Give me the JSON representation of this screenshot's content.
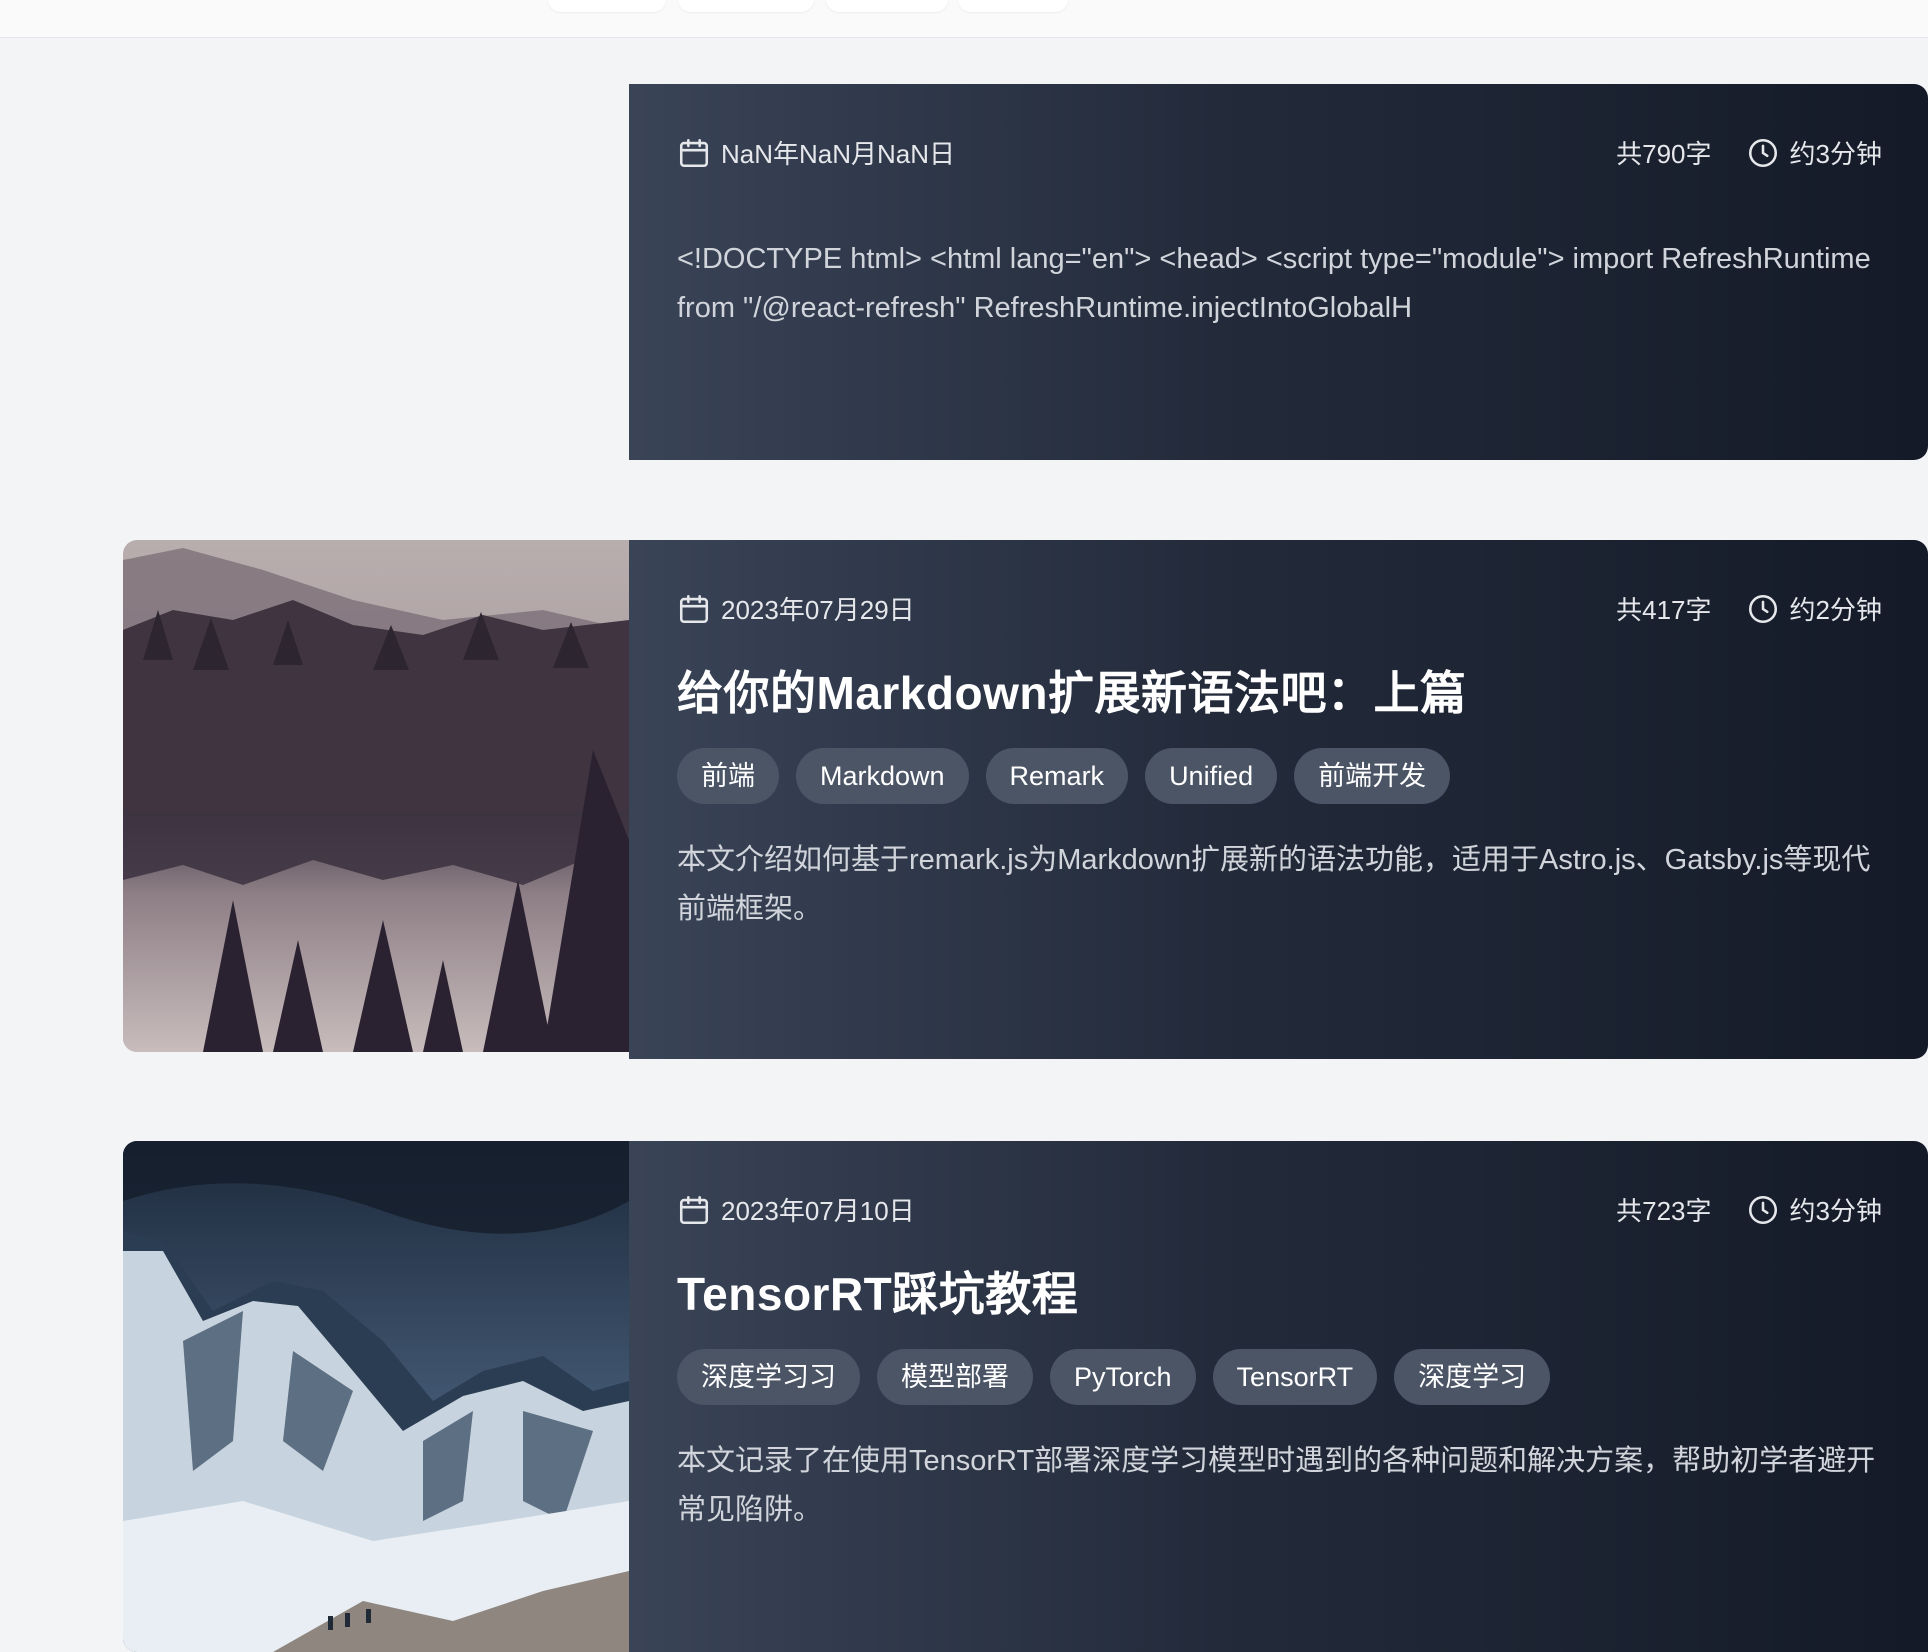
{
  "posts": [
    {
      "date": "NaN年NaN月NaN日",
      "word_count": "共790字",
      "read_time": "约3分钟",
      "title": "",
      "tags": [],
      "excerpt": "<!DOCTYPE html> <html lang=\"en\"> <head> <script type=\"module\"> import RefreshRuntime from \"/@react-refresh\" RefreshRuntime.injectIntoGlobalH",
      "has_image": false
    },
    {
      "date": "2023年07月29日",
      "word_count": "共417字",
      "read_time": "约2分钟",
      "title": "给你的Markdown扩展新语法吧：上篇",
      "tags": [
        "前端",
        "Markdown",
        "Remark",
        "Unified",
        "前端开发"
      ],
      "excerpt": "本文介绍如何基于remark.js为Markdown扩展新的语法功能，适用于Astro.js、Gatsby.js等现代前端框架。",
      "has_image": true,
      "image_subject": "forest-lake"
    },
    {
      "date": "2023年07月10日",
      "word_count": "共723字",
      "read_time": "约3分钟",
      "title": "TensorRT踩坑教程",
      "tags": [
        "深度学习习",
        "模型部署",
        "PyTorch",
        "TensorRT",
        "深度学习"
      ],
      "excerpt": "本文记录了在使用TensorRT部署深度学习模型时遇到的各种问题和解决方案，帮助初学者避开常见陷阱。",
      "has_image": true,
      "image_subject": "snowy-mountains"
    }
  ],
  "colors": {
    "page_bg": "#f3f4f6",
    "card_gradient_start": "#3a4457",
    "card_gradient_end": "#141a27",
    "tag_bg": "#4b5566"
  }
}
